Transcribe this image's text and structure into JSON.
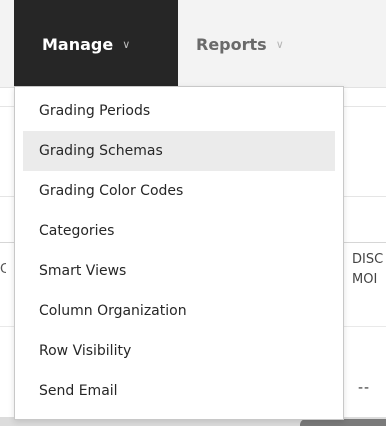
{
  "tabs": {
    "manage_label": "Manage",
    "reports_label": "Reports"
  },
  "manage_menu": {
    "items": [
      {
        "label": "Grading Periods"
      },
      {
        "label": "Grading Schemas",
        "highlighted": true
      },
      {
        "label": "Grading Color Codes"
      },
      {
        "label": "Categories"
      },
      {
        "label": "Smart Views"
      },
      {
        "label": "Column Organization"
      },
      {
        "label": "Row Visibility"
      },
      {
        "label": "Send Email"
      }
    ]
  },
  "background": {
    "column_header_line1": "DISC",
    "column_header_line2": "MOI",
    "left_mark": "C",
    "cell_value": "--"
  },
  "colors": {
    "active_tab_bg": "#262626",
    "tabbar_bg": "#f3f3f3",
    "menu_highlight": "#ebebeb"
  }
}
